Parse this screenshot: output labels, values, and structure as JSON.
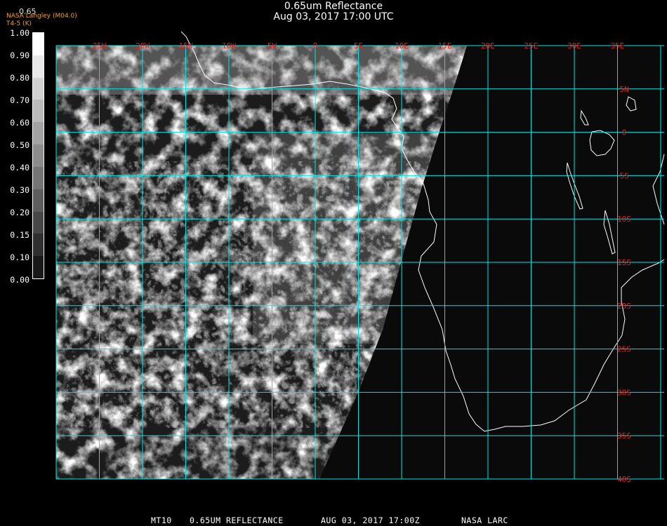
{
  "header": {
    "title": "0.65um Reflectance",
    "subtitle": "Aug 03, 2017 17:00 UTC"
  },
  "credit": {
    "line1": "NASA Langley (M04.0)",
    "line2": "T4-5 (K)",
    "overlay": "0.65"
  },
  "colorbar": {
    "labels": [
      "1.00",
      "0.90",
      "0.80",
      "0.70",
      "0.60",
      "0.50",
      "0.40",
      "0.30",
      "0.20",
      "0.15",
      "0.10",
      "0.00"
    ],
    "colors": {
      "high": "#ffffff",
      "low": "#000000"
    }
  },
  "map": {
    "lon_labels": [
      "25W",
      "20W",
      "15W",
      "10W",
      "5W",
      "0",
      "5E",
      "10E",
      "15E",
      "20E",
      "25E",
      "30E",
      "35E"
    ],
    "lat_labels": [
      "5N",
      "0",
      "5S",
      "10S",
      "15S",
      "20S",
      "25S",
      "30S",
      "35S",
      "40S"
    ],
    "colors": {
      "grid": "#00e5e5",
      "labels": "#e02020",
      "coast": "#ffffff",
      "background": "#0a0a0a"
    }
  },
  "footer": {
    "sat": "MT10",
    "product": "0.65UM REFLECTANCE",
    "datetime": "AUG 03, 2017 17:00Z",
    "org": "NASA LARC"
  }
}
